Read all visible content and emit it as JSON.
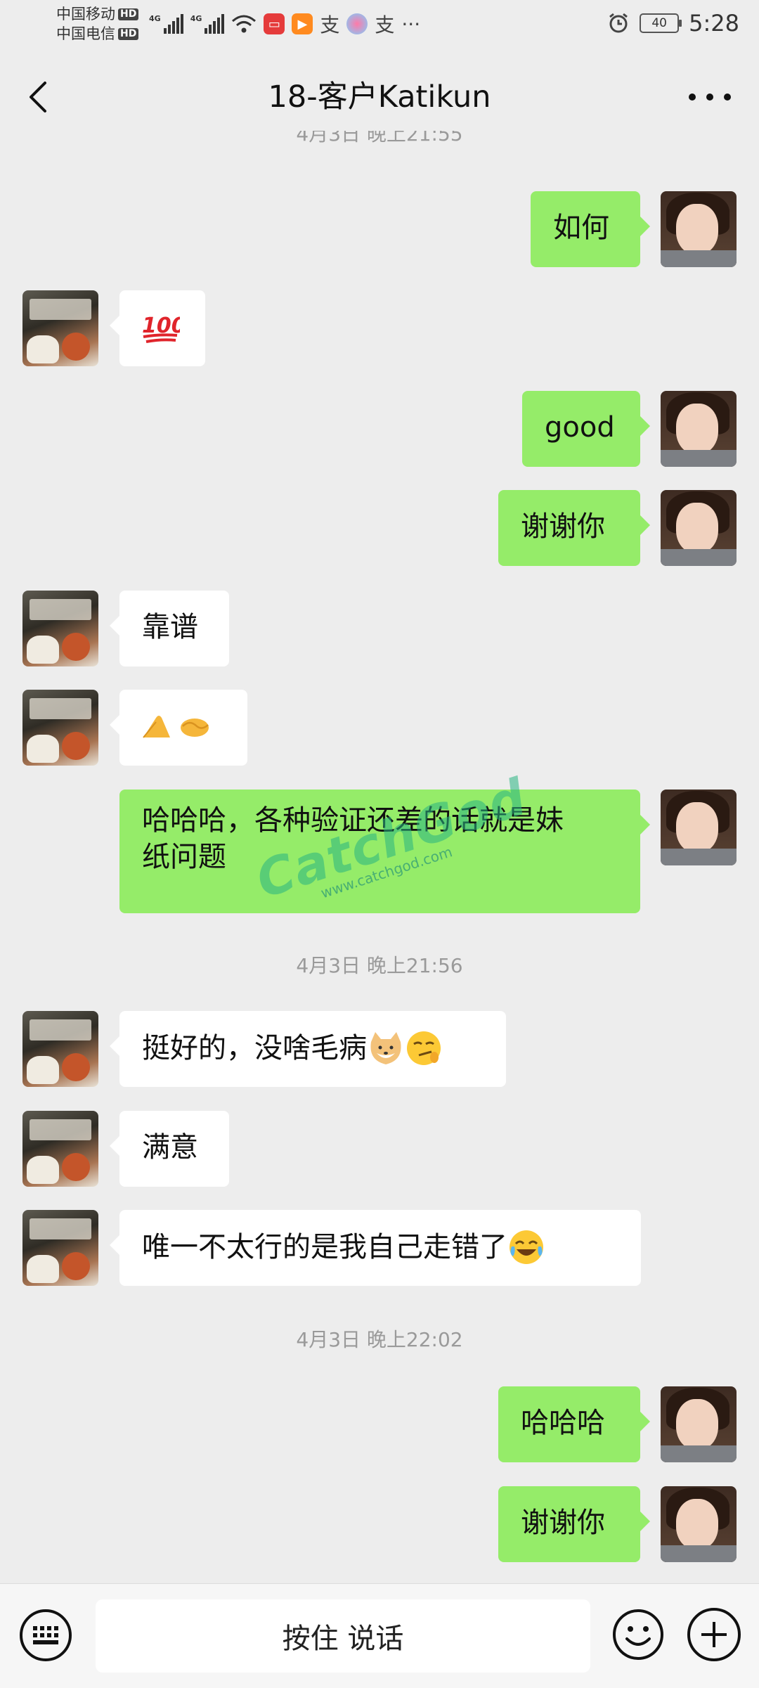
{
  "status_bar": {
    "carrier_1": "中国移动",
    "carrier_2": "中国电信",
    "hd_badge": "HD",
    "network_type": "4G",
    "battery": "40",
    "time": "5:28",
    "app_icons": [
      "book-app-icon",
      "video-app-icon",
      "alipay-icon",
      "circle-app-icon",
      "alipay-icon"
    ],
    "more_notifications": "···"
  },
  "header": {
    "title": "18-客户Katikun"
  },
  "timestamps": {
    "top_partial": "4月3日 晚上21:55",
    "t2": "4月3日 晚上21:56",
    "t3": "4月3日 晚上22:02"
  },
  "messages": [
    {
      "side": "right",
      "text": "如何"
    },
    {
      "side": "left",
      "emoji": "hundred-points-emoji"
    },
    {
      "side": "right",
      "text": "good"
    },
    {
      "side": "right",
      "text": "谢谢你"
    },
    {
      "side": "left",
      "text": "靠谱"
    },
    {
      "side": "left",
      "emoji": "hands-emoji"
    },
    {
      "side": "right",
      "line1": "哈哈哈，各种验证还差的话就是妹",
      "line2": "纸问题"
    },
    {
      "side": "left",
      "text": "挺好的，没啥毛病"
    },
    {
      "side": "left",
      "text": "满意"
    },
    {
      "side": "left",
      "text": "唯一不太行的是我自己走错了"
    },
    {
      "side": "right",
      "text": "哈哈哈"
    },
    {
      "side": "right",
      "text": "谢谢你"
    }
  ],
  "watermark": {
    "brand": "CatchGod",
    "url": "www.catchgod.com"
  },
  "input_bar": {
    "hold_to_talk": "按住 说话"
  },
  "colors": {
    "background": "#ededed",
    "bubble_self": "#95ec69",
    "bubble_other": "#ffffff",
    "timestamp": "#9a9a9a"
  }
}
